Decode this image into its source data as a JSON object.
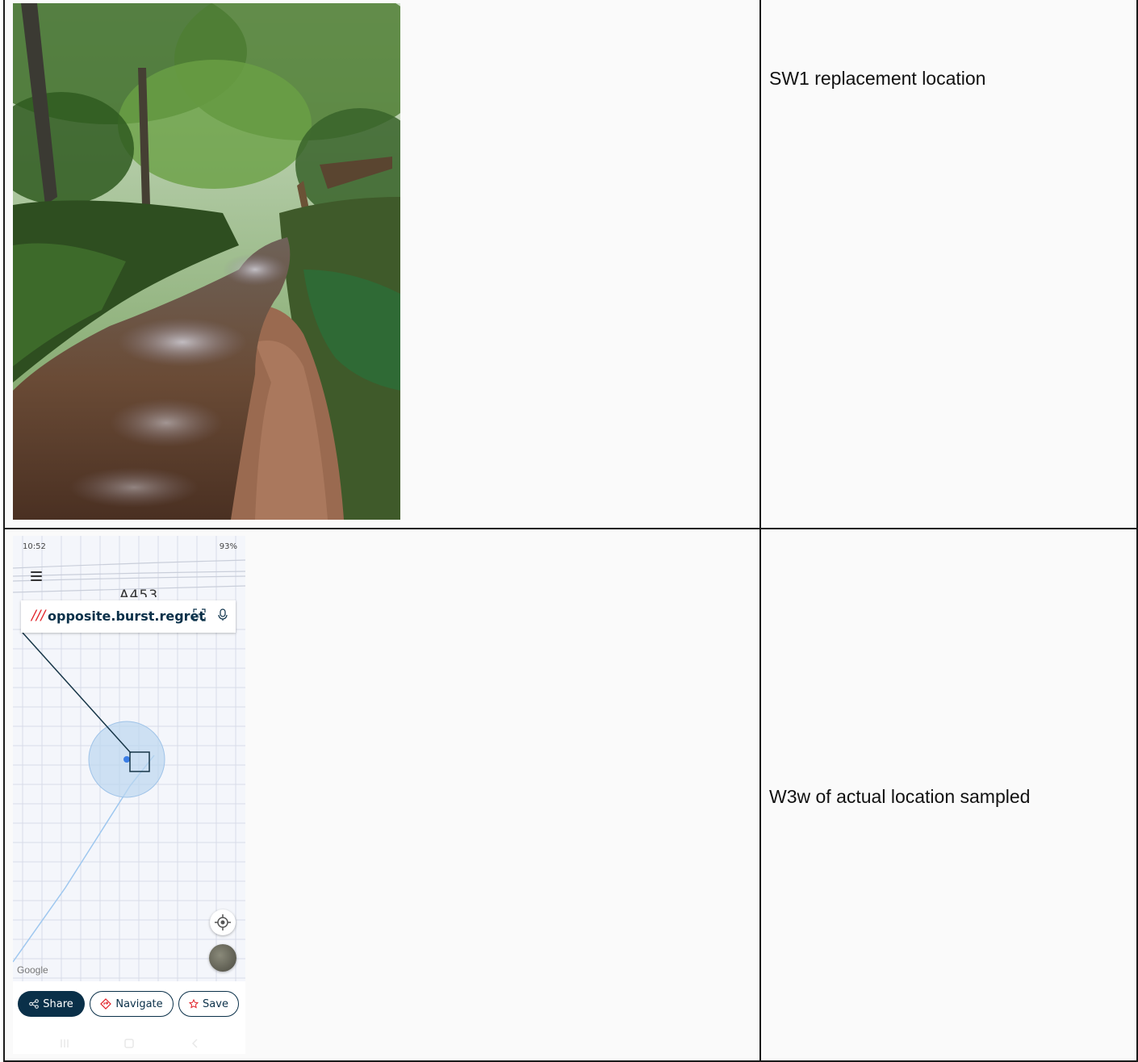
{
  "table": {
    "rows": [
      {
        "description": "SW1 replacement location"
      },
      {
        "description": "W3w of actual location sampled"
      }
    ]
  },
  "phone": {
    "status_time": "10:52",
    "status_right": "93%",
    "road_label": "A453",
    "w3w_slashes": "///",
    "w3w_address": "opposite.burst.regret",
    "google_logo": "Google",
    "buttons": {
      "share": "Share",
      "navigate": "Navigate",
      "save": "Save"
    },
    "colors": {
      "brand_navy": "#0a3049",
      "w3w_red": "#e11f26",
      "accuracy_circle": "#bcd7f0",
      "location_dot": "#3b7ee6"
    }
  }
}
